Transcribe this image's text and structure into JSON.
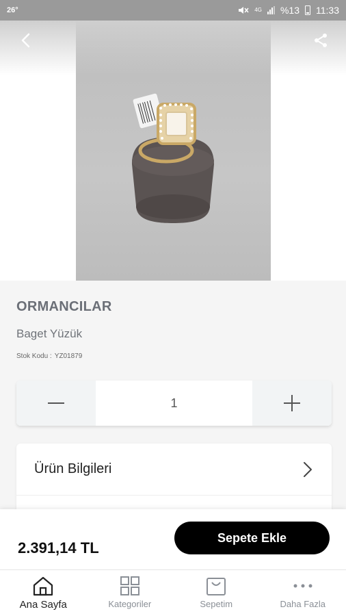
{
  "status_bar": {
    "temperature": "26°",
    "network": "4G",
    "battery": "%13",
    "time": "11:33"
  },
  "header": {
    "back_icon": "chevron-left-icon",
    "share_icon": "share-icon"
  },
  "product": {
    "brand": "ORMANCILAR",
    "name": "Baget Yüzük",
    "stock_label": "Stok Kodu :",
    "stock_code": "YZ01879"
  },
  "quantity": {
    "value": "1",
    "decrease_icon": "minus-icon",
    "increase_icon": "plus-icon"
  },
  "details": {
    "product_info_label": "Ürün Bilgileri"
  },
  "purchase": {
    "price": "2.391,14 TL",
    "add_to_cart_label": "Sepete Ekle"
  },
  "bottom_nav": {
    "items": [
      {
        "label": "Ana Sayfa",
        "icon": "home-icon",
        "active": true
      },
      {
        "label": "Kategoriler",
        "icon": "grid-icon",
        "active": false
      },
      {
        "label": "Sepetim",
        "icon": "cart-icon",
        "active": false
      },
      {
        "label": "Daha Fazla",
        "icon": "more-icon",
        "active": false
      }
    ]
  }
}
